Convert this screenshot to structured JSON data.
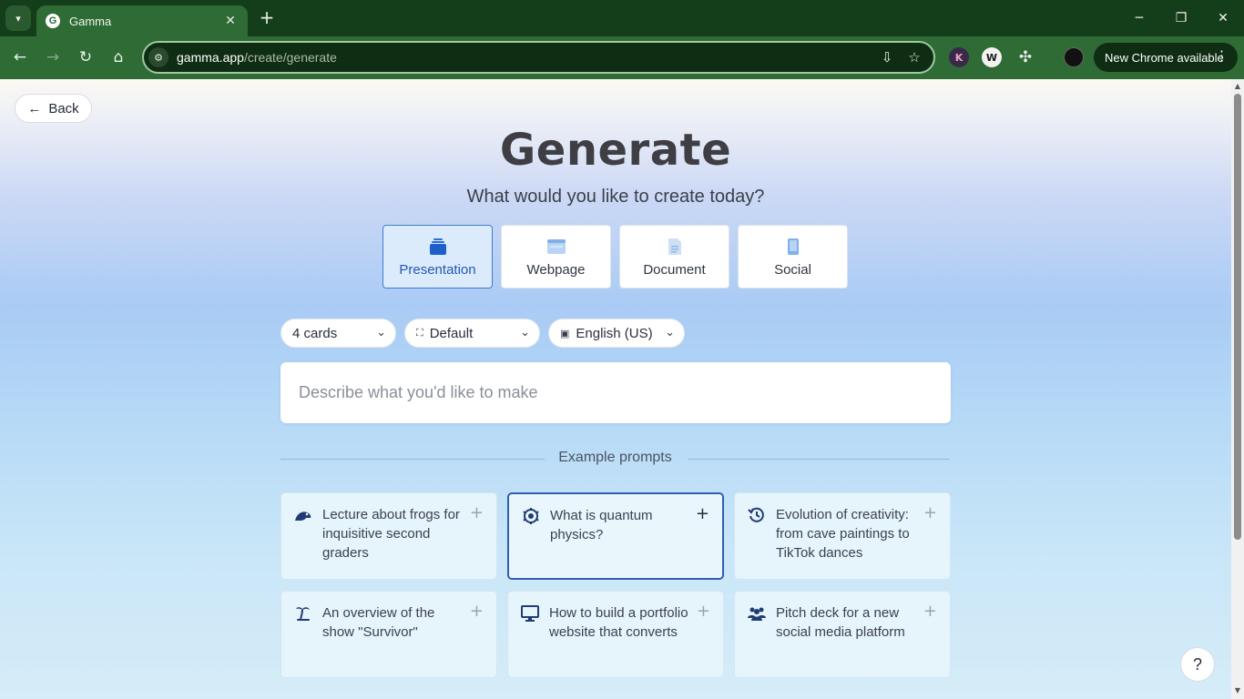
{
  "browser": {
    "tab_title": "Gamma",
    "favicon_letter": "G",
    "url_host": "gamma.app",
    "url_path": "/create/generate",
    "update_label": "New Chrome available",
    "extensions": [
      "K",
      "W"
    ]
  },
  "page": {
    "back_label": "Back",
    "title": "Generate",
    "subtitle": "What would you like to create today?",
    "types": [
      {
        "label": "Presentation",
        "icon": "presentation-icon",
        "active": true
      },
      {
        "label": "Webpage",
        "icon": "webpage-icon",
        "active": false
      },
      {
        "label": "Document",
        "icon": "document-icon",
        "active": false
      },
      {
        "label": "Social",
        "icon": "social-icon",
        "active": false
      }
    ],
    "selectors": {
      "cards": "4 cards",
      "theme": "Default",
      "language": "English (US)"
    },
    "prompt_placeholder": "Describe what you'd like to make",
    "examples_title": "Example prompts",
    "examples": [
      {
        "text": "Lecture about frogs for inquisitive second graders",
        "icon": "frog-icon"
      },
      {
        "text": "What is quantum physics?",
        "icon": "atom-icon"
      },
      {
        "text": "Evolution of creativity: from cave paintings to TikTok dances",
        "icon": "history-icon"
      },
      {
        "text": "An overview of the show \"Survivor\"",
        "icon": "island-icon"
      },
      {
        "text": "How to build a portfolio website that converts",
        "icon": "monitor-icon"
      },
      {
        "text": "Pitch deck for a new social media platform",
        "icon": "users-icon"
      }
    ],
    "help_label": "?"
  },
  "colors": {
    "accent": "#2158b5",
    "browser_frame": "#2f6b35"
  }
}
